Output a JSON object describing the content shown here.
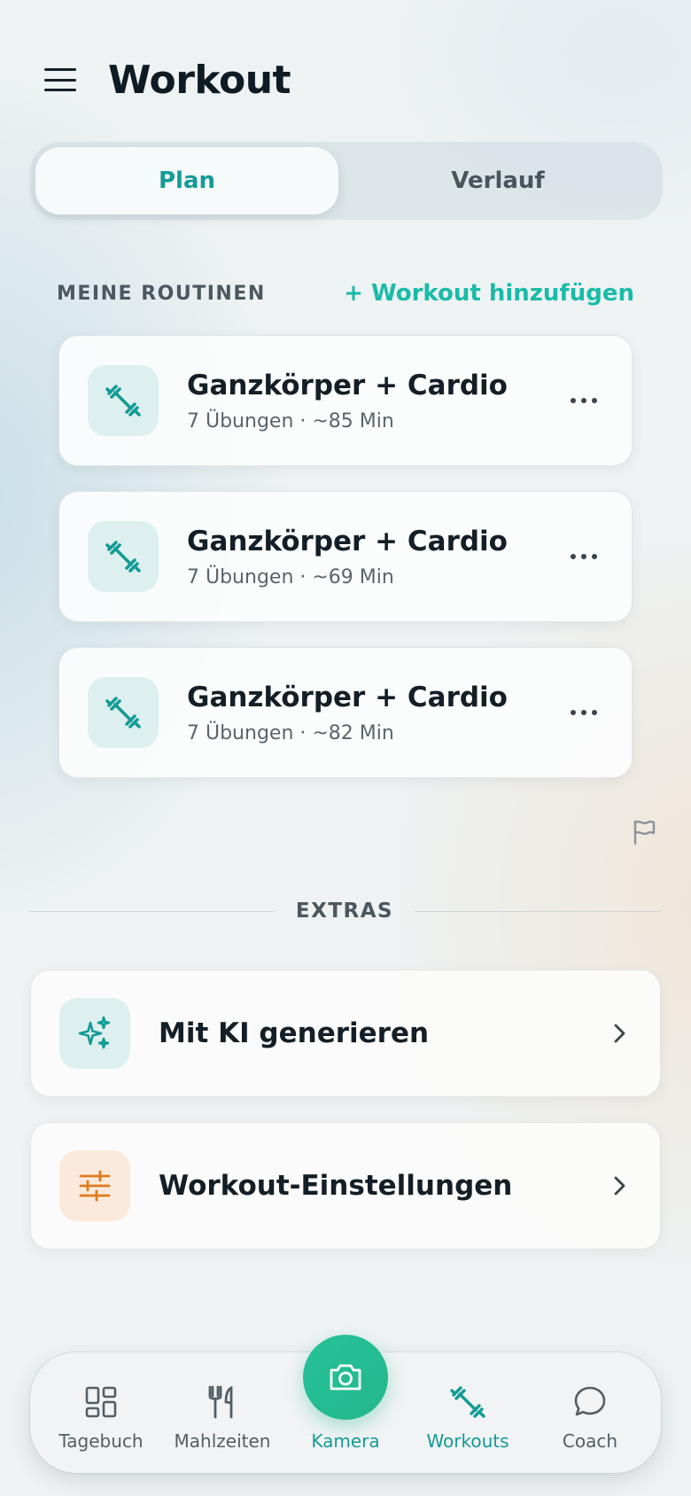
{
  "header": {
    "title": "Workout",
    "menu_icon": "hamburger-menu-icon"
  },
  "segmented": {
    "tabs": [
      {
        "label": "Plan",
        "active": true
      },
      {
        "label": "Verlauf",
        "active": false
      }
    ]
  },
  "routines_section": {
    "label": "MEINE ROUTINEN",
    "add_label": "+ Workout hinzufügen",
    "items": [
      {
        "title": "Ganzkörper + Cardio",
        "subtitle": "7 Übungen · ~85 Min",
        "icon": "dumbbell-icon"
      },
      {
        "title": "Ganzkörper + Cardio",
        "subtitle": "7 Übungen · ~69 Min",
        "icon": "dumbbell-icon"
      },
      {
        "title": "Ganzkörper + Cardio",
        "subtitle": "7 Übungen · ~82 Min",
        "icon": "dumbbell-icon"
      }
    ]
  },
  "extras": {
    "label": "EXTRAS",
    "items": [
      {
        "label": "Mit KI generieren",
        "icon": "sparkles-icon"
      },
      {
        "label": "Workout-Einstellungen",
        "icon": "sliders-icon"
      }
    ]
  },
  "bottom_nav": {
    "items": [
      {
        "label": "Tagebuch",
        "icon": "grid-icon",
        "active": false
      },
      {
        "label": "Mahlzeiten",
        "icon": "fork-knife-icon",
        "active": false
      },
      {
        "label": "Kamera",
        "icon": "camera-icon",
        "active": false
      },
      {
        "label": "Workouts",
        "icon": "dumbbell-icon",
        "active": true
      },
      {
        "label": "Coach",
        "icon": "chat-bubble-icon",
        "active": false
      }
    ]
  },
  "colors": {
    "accent": "#139b95",
    "accent_bright": "#19bba8",
    "camera_green": "#22b78a",
    "settings_orange": "#e07a1f"
  }
}
